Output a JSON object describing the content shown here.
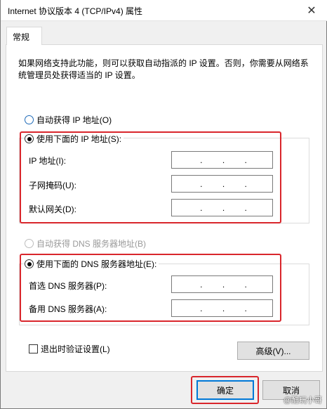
{
  "window": {
    "title": "Internet 协议版本 4 (TCP/IPv4) 属性",
    "close_glyph": "✕"
  },
  "tabs": [
    {
      "label": "常规"
    }
  ],
  "description": "如果网络支持此功能，则可以获取自动指派的 IP 设置。否则，你需要从网络系统管理员处获得适当的 IP 设置。",
  "ip_section": {
    "auto_label": "自动获得 IP 地址(O)",
    "manual_label": "使用下面的 IP 地址(S):",
    "auto_selected": false,
    "fields": [
      {
        "label": "IP 地址(I):",
        "dots": [
          ".",
          ".",
          "."
        ]
      },
      {
        "label": "子网掩码(U):",
        "dots": [
          ".",
          ".",
          "."
        ]
      },
      {
        "label": "默认网关(D):",
        "dots": [
          ".",
          ".",
          "."
        ]
      }
    ]
  },
  "dns_section": {
    "auto_label": "自动获得 DNS 服务器地址(B)",
    "manual_label": "使用下面的 DNS 服务器地址(E):",
    "auto_enabled": false,
    "fields": [
      {
        "label": "首选 DNS 服务器(P):",
        "dots": [
          ".",
          ".",
          "."
        ]
      },
      {
        "label": "备用 DNS 服务器(A):",
        "dots": [
          ".",
          ".",
          "."
        ]
      }
    ]
  },
  "validate_checkbox": {
    "label": "退出时验证设置(L)",
    "checked": false
  },
  "buttons": {
    "advanced": "高级(V)...",
    "ok": "确定",
    "cancel": "取消"
  },
  "watermark": "@酷玩小哥",
  "colors": {
    "highlight_border": "#d9262c",
    "accent": "#0078d7"
  }
}
